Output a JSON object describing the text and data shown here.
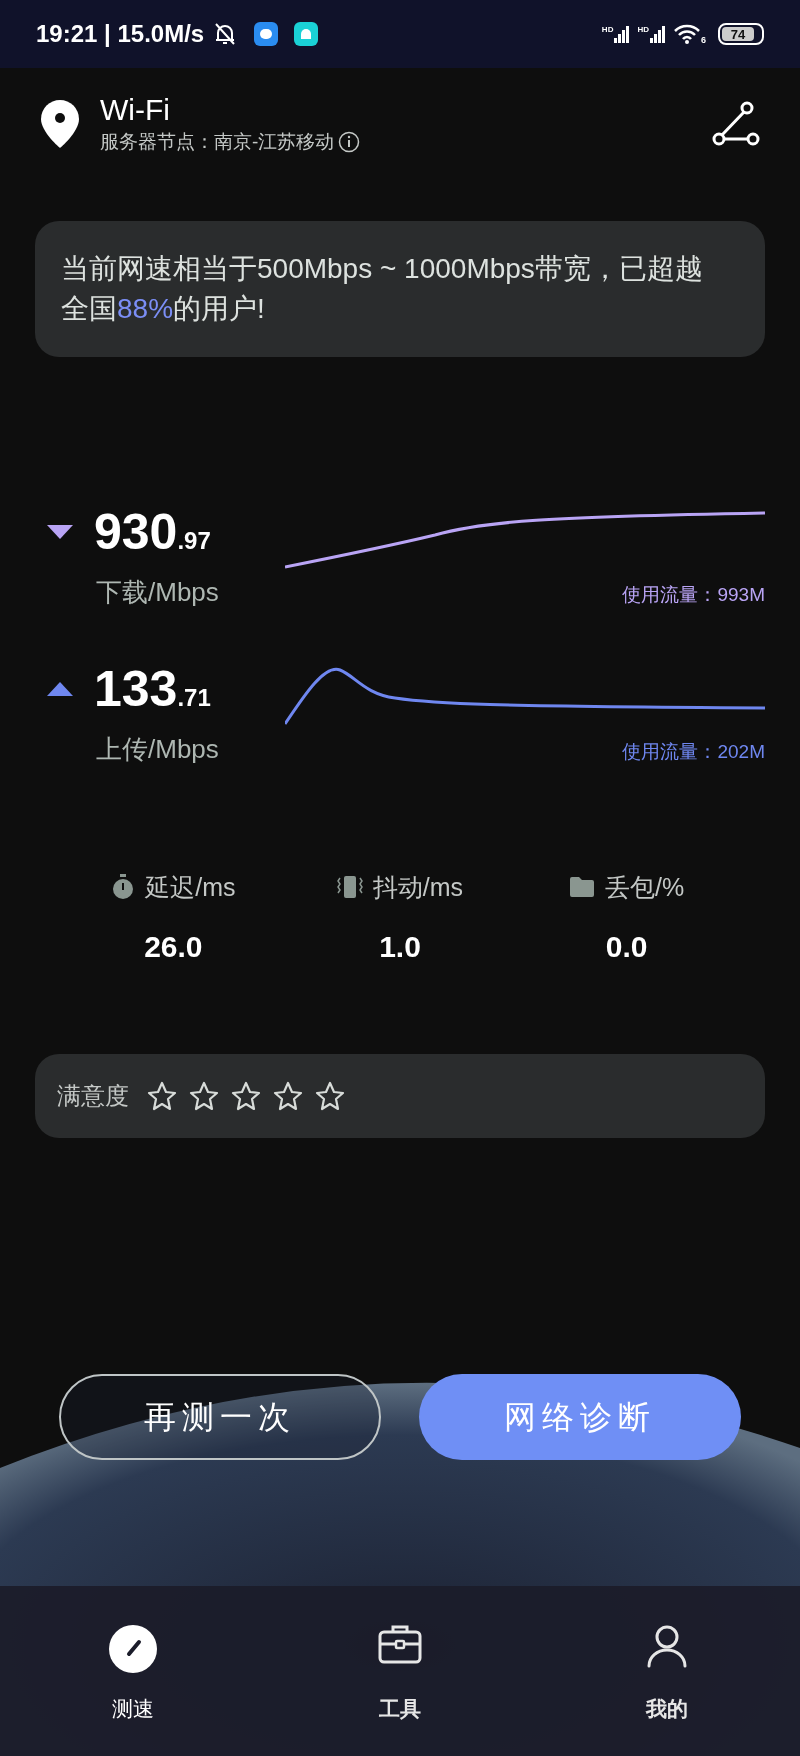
{
  "status_bar": {
    "time_speed": "19:21 | 15.0M/s",
    "signal_labels": [
      "HD",
      "HD"
    ],
    "wifi_label": "6",
    "battery": "74"
  },
  "header": {
    "title": "Wi-Fi",
    "server": "服务器节点：南京-江苏移动"
  },
  "summary": "当前网速相当于500Mbps ~ 1000Mbps带宽，已超越全国**88%**的用户!",
  "speeds": [
    {
      "kind": "download",
      "value": "930",
      "decimals": ".97",
      "unit": "下载/Mbps",
      "traffic": "使用流量：993M",
      "color": "#b9a4f5"
    },
    {
      "kind": "upload",
      "value": "133",
      "decimals": ".71",
      "unit": "上传/Mbps",
      "traffic": "使用流量：202M",
      "color": "#6f87f0"
    }
  ],
  "stats": [
    {
      "kind": "latency",
      "label": "延迟/ms",
      "value": "26.0"
    },
    {
      "kind": "jitter",
      "label": "抖动/ms",
      "value": "1.0"
    },
    {
      "kind": "loss",
      "label": "丢包/%",
      "value": "0.0"
    }
  ],
  "rating": {
    "label": "满意度",
    "stars": 0
  },
  "buttons": [
    {
      "kind": "outline",
      "label": "再测一次"
    },
    {
      "kind": "filled",
      "label": "网络诊断"
    }
  ],
  "tabs": [
    {
      "kind": "speed",
      "label": "测速",
      "selected": true
    },
    {
      "kind": "tools",
      "label": "工具",
      "selected": false
    },
    {
      "kind": "profile",
      "label": "我的",
      "selected": false
    }
  ]
}
